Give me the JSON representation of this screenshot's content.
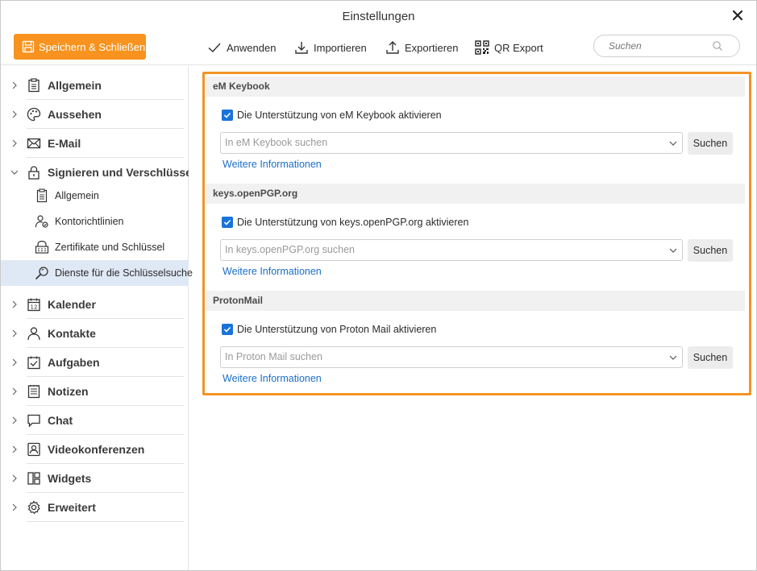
{
  "window": {
    "title": "Einstellungen"
  },
  "toolbar": {
    "save_label": "Speichern & Schließen",
    "apply_label": "Anwenden",
    "import_label": "Importieren",
    "export_label": "Exportieren",
    "qr_label": "QR Export",
    "search_placeholder": "Suchen"
  },
  "sidebar": {
    "items": [
      {
        "label": "Allgemein",
        "icon": "clipboard-icon"
      },
      {
        "label": "Aussehen",
        "icon": "palette-icon"
      },
      {
        "label": "E-Mail",
        "icon": "envelope-icon"
      },
      {
        "label": "Signieren und Verschlüsselung",
        "icon": "lock-icon",
        "expanded": true
      },
      {
        "label": "Kalender",
        "icon": "calendar-icon"
      },
      {
        "label": "Kontakte",
        "icon": "person-icon"
      },
      {
        "label": "Aufgaben",
        "icon": "task-icon"
      },
      {
        "label": "Notizen",
        "icon": "note-icon"
      },
      {
        "label": "Chat",
        "icon": "chat-icon"
      },
      {
        "label": "Videokonferenzen",
        "icon": "video-icon"
      },
      {
        "label": "Widgets",
        "icon": "widgets-icon"
      },
      {
        "label": "Erweitert",
        "icon": "gear-icon"
      }
    ],
    "subitems": [
      {
        "label": "Allgemein",
        "icon": "clipboard-icon"
      },
      {
        "label": "Kontorichtlinien",
        "icon": "account-policy-icon"
      },
      {
        "label": "Zertifikate und Schlüssel",
        "icon": "certificate-lock-icon"
      },
      {
        "label": "Dienste für die Schlüsselsuche",
        "icon": "key-search-icon",
        "active": true
      }
    ]
  },
  "sections": [
    {
      "title": "eM Keybook",
      "checkbox_label": "Die Unterstützung von eM Keybook aktivieren",
      "checked": true,
      "dropdown_placeholder": "In eM Keybook suchen",
      "button_label": "Suchen",
      "link_label": "Weitere Informationen"
    },
    {
      "title": "keys.openPGP.org",
      "checkbox_label": "Die Unterstützung von keys.openPGP.org aktivieren",
      "checked": true,
      "dropdown_placeholder": "In keys.openPGP.org suchen",
      "button_label": "Suchen",
      "link_label": "Weitere Informationen"
    },
    {
      "title": "ProtonMail",
      "checkbox_label": "Die Unterstützung von Proton Mail aktivieren",
      "checked": true,
      "dropdown_placeholder": "In Proton Mail suchen",
      "button_label": "Suchen",
      "link_label": "Weitere Informationen"
    }
  ],
  "colors": {
    "accent": "#f7931e",
    "highlight_border": "#f39323",
    "checkbox": "#1a73d9",
    "link": "#1a6ec8",
    "active_bg": "#dfe8f5"
  }
}
